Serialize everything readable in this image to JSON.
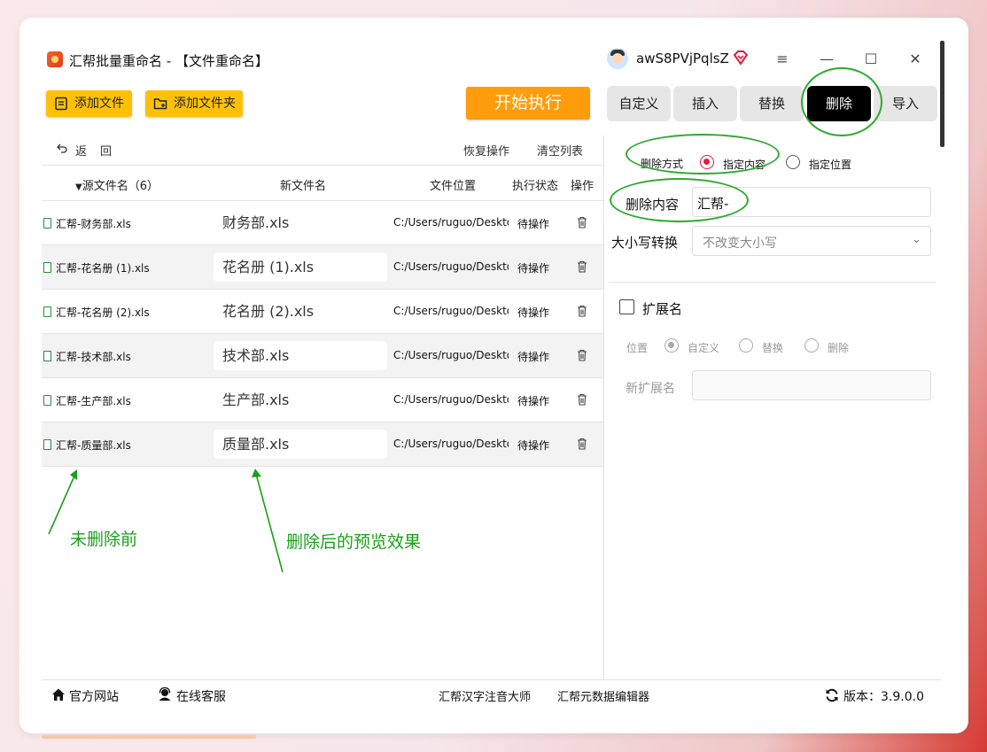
{
  "window": {
    "title": "汇帮批量重命名 - 【文件重命名】",
    "username": "awS8PVjPqlsZ",
    "controls": {
      "menu": "≡",
      "minimize": "—",
      "maximize": "☐",
      "close": "✕"
    }
  },
  "toolbar": {
    "add_file": "添加文件",
    "add_folder": "添加文件夹",
    "start": "开始执行"
  },
  "tabs": [
    "自定义",
    "插入",
    "替换",
    "删除",
    "导入"
  ],
  "active_tab": "删除",
  "list_actions": {
    "back": "返",
    "back2": "回",
    "restore": "恢复操作",
    "clear": "清空列表"
  },
  "columns": {
    "source": "源文件名（6）",
    "new_name": "新文件名",
    "location": "文件位置",
    "status": "执行状态",
    "action": "操作"
  },
  "rows": [
    {
      "source": "汇帮-财务部.xls",
      "new_name": "财务部.xls",
      "location": "C:/Users/ruguo/Deskto",
      "status": "待操作"
    },
    {
      "source": "汇帮-花名册 (1).xls",
      "new_name": "花名册 (1).xls",
      "location": "C:/Users/ruguo/Deskto",
      "status": "待操作"
    },
    {
      "source": "汇帮-花名册 (2).xls",
      "new_name": "花名册 (2).xls",
      "location": "C:/Users/ruguo/Deskto",
      "status": "待操作"
    },
    {
      "source": "汇帮-技术部.xls",
      "new_name": "技术部.xls",
      "location": "C:/Users/ruguo/Deskto",
      "status": "待操作"
    },
    {
      "source": "汇帮-生产部.xls",
      "new_name": "生产部.xls",
      "location": "C:/Users/ruguo/Deskto",
      "status": "待操作"
    },
    {
      "source": "汇帮-质量部.xls",
      "new_name": "质量部.xls",
      "location": "C:/Users/ruguo/Deskto",
      "status": "待操作"
    }
  ],
  "settings": {
    "delete_mode_label": "删除方式",
    "mode_content": "指定内容",
    "mode_position": "指定位置",
    "delete_content_label": "删除内容",
    "delete_content_value": "汇帮-",
    "case_label": "大小写转换",
    "case_value": "不改变大小写",
    "ext_label": "扩展名",
    "pos_label": "位置",
    "pos_custom": "自定义",
    "pos_replace": "替换",
    "pos_delete": "删除",
    "new_ext_label": "新扩展名",
    "new_ext_value": ""
  },
  "annotations": {
    "before": "未删除前",
    "after": "删除后的预览效果"
  },
  "footer": {
    "website": "官方网站",
    "support": "在线客服",
    "pinyin": "汇帮汉字注音大师",
    "metadata": "汇帮元数据编辑器",
    "version": "版本：3.9.0.0"
  },
  "colors": {
    "toolbar_button": "#ffc107",
    "start_button": "#ff9c0c",
    "active_tab": "#000000",
    "radio_selected": "#e4193e",
    "annotation": "#1aa01a"
  }
}
